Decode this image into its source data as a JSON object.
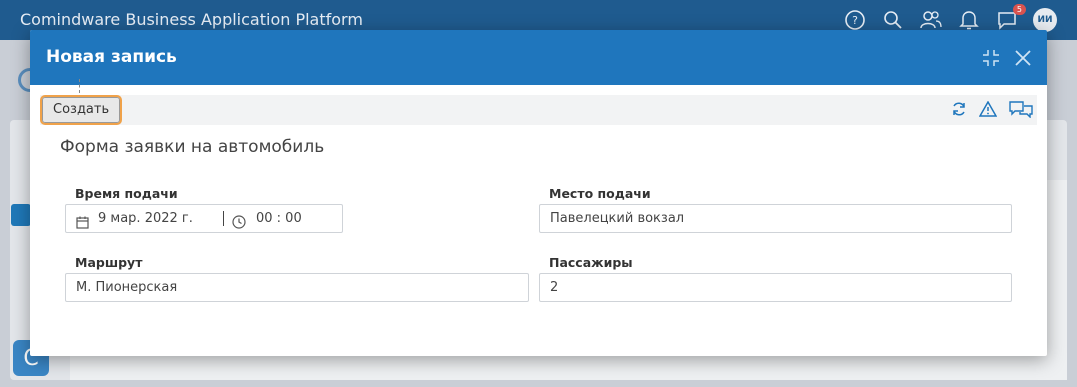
{
  "app": {
    "title": "Comindware Business Application Platform",
    "notification_count": "5",
    "avatar_initials": "ИИ"
  },
  "modal": {
    "title": "Новая запись"
  },
  "toolbar": {
    "create_label": "Создать"
  },
  "form": {
    "title": "Форма заявки на автомобиль",
    "pickup_time": {
      "label": "Время подачи",
      "date": "9 мар. 2022 г.",
      "time": "00 : 00"
    },
    "pickup_place": {
      "label": "Место подачи",
      "value": "Павелецкий вокзал"
    },
    "route": {
      "label": "Маршрут",
      "value": "М. Пионерская"
    },
    "passengers": {
      "label": "Пассажиры",
      "value": "2"
    }
  },
  "colors": {
    "header": "#1f5b8f",
    "modal_header": "#1f76bd",
    "focus_outline": "#f0a24a"
  }
}
